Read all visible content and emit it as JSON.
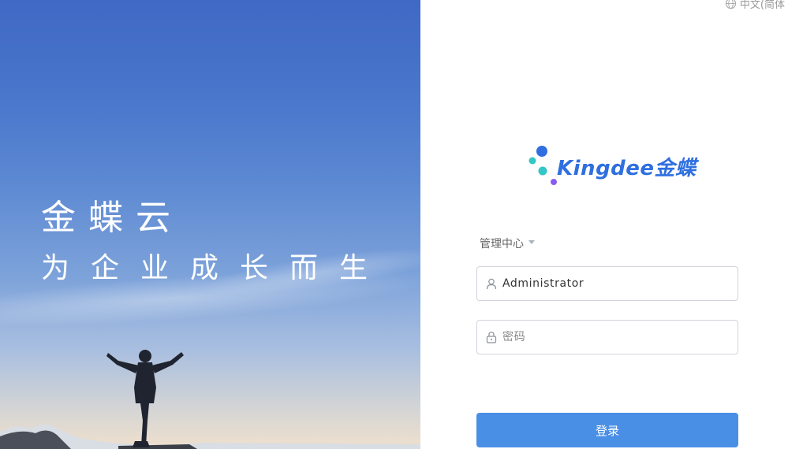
{
  "hero": {
    "title": "金蝶云",
    "subtitle": "为企业成长而生"
  },
  "language": {
    "label": "中文(简体",
    "icon": "globe-icon"
  },
  "logo": {
    "wordmark": "Kingdee金蝶",
    "colors": {
      "blue": "#2f6fe0",
      "teal": "#35c6c6",
      "purple": "#8a5cf0"
    }
  },
  "login": {
    "center_label": "管理中心",
    "username_value": "Administrator",
    "username_icon": "user-icon",
    "password_placeholder": "密码",
    "password_icon": "lock-icon",
    "submit_label": "登录"
  },
  "colors": {
    "accent": "#4a8fe6",
    "input_border": "#d0d4da"
  }
}
